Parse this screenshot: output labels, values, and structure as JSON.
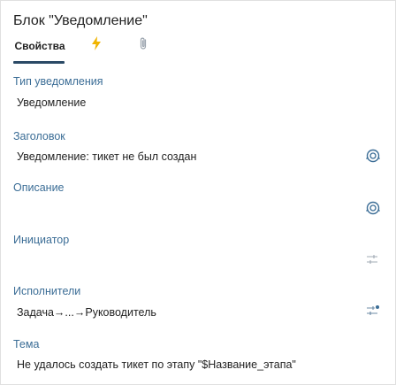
{
  "panel": {
    "title": "Блок \"Уведомление\"",
    "tabs": [
      {
        "label": "Свойства",
        "active": true
      },
      {
        "icon": "lightning-icon",
        "active": false
      },
      {
        "icon": "paperclip-icon",
        "active": false
      }
    ]
  },
  "fields": {
    "notification_type": {
      "label": "Тип уведомления",
      "value": "Уведомление"
    },
    "header": {
      "label": "Заголовок",
      "value": "Уведомление: тикет не был создан",
      "icon": "expression-icon"
    },
    "description": {
      "label": "Описание",
      "value": "",
      "icon": "expression-icon"
    },
    "initiator": {
      "label": "Инициатор",
      "value": "",
      "icon": "assignee-settings-icon"
    },
    "performers": {
      "label": "Исполнители",
      "value": "Задача→...→Руководитель",
      "icon": "assignee-settings-icon"
    },
    "subject": {
      "label": "Тема",
      "value": "Не удалось создать тикет по этапу \"$Название_этапа\""
    }
  },
  "colors": {
    "label": "#3b6d96",
    "accent": "#2b4a66",
    "lightning": "#f0b400",
    "icon": "#3b6d96",
    "icon_muted": "#b5bcc4"
  }
}
